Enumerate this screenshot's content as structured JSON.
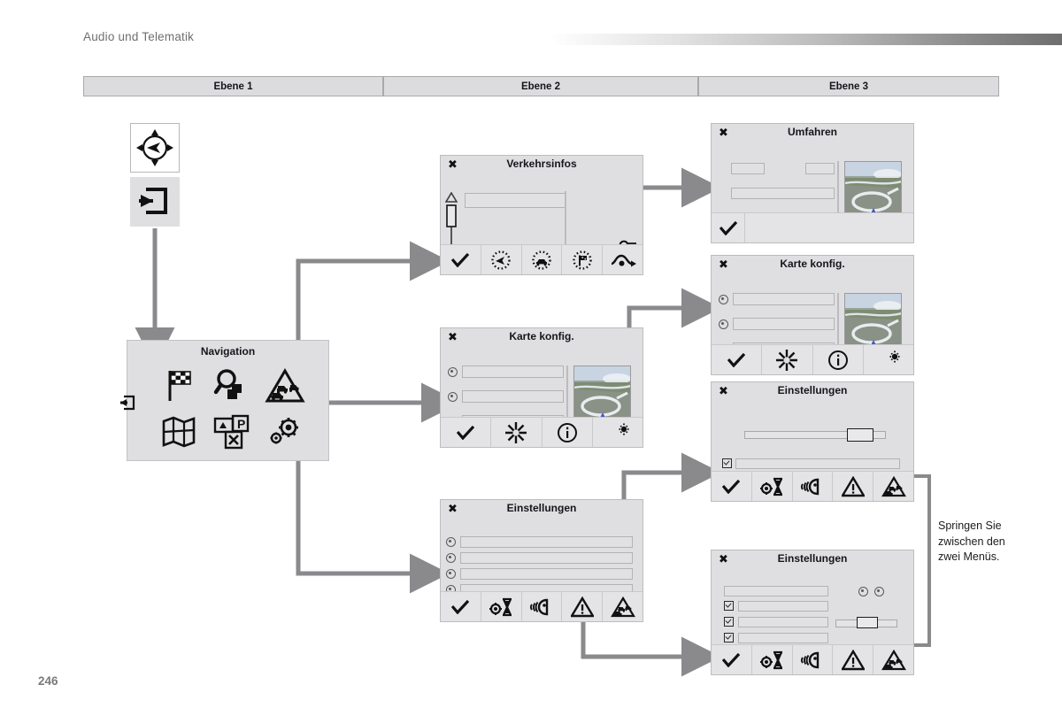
{
  "header": {
    "title": "Audio und Telematik",
    "page_number": "246"
  },
  "columns": [
    {
      "label": "Ebene 1"
    },
    {
      "label": "Ebene 2"
    },
    {
      "label": "Ebene 3"
    }
  ],
  "entry_controls": [
    {
      "name": "dpad-icon",
      "label": "joystick-dpad"
    },
    {
      "name": "enter-menu-icon",
      "label": "enter-menu"
    }
  ],
  "navigation_panel": {
    "title": "Navigation",
    "exit_icon": "exit-left-icon",
    "items": [
      {
        "icon": "checkered-flag-icon",
        "label": "Ziel eingeben"
      },
      {
        "icon": "magnifier-files-icon",
        "label": "Adressbuch"
      },
      {
        "icon": "traffic-jam-icon",
        "label": "Verkehrsinfos"
      },
      {
        "icon": "map-icon",
        "label": "Karte"
      },
      {
        "icon": "poi-parking-restaurant-icon",
        "label": "POI"
      },
      {
        "icon": "gears-icon",
        "label": "Einstellungen"
      }
    ]
  },
  "screens": {
    "verkehrsinfos": {
      "title": "Verkehrsinfos",
      "close_icon": "close-icon",
      "scrollbar": {
        "up_icon": "triangle-up-icon",
        "down_icon": "triangle-down-icon"
      },
      "list_field": "",
      "corner_icon": "traffic-list-icon",
      "toolbar": [
        {
          "icon": "check-icon",
          "label": "OK"
        },
        {
          "icon": "dotted-navigation-arrow-icon",
          "label": "Navigation"
        },
        {
          "icon": "dotted-car-icon",
          "label": "Fahrzeug"
        },
        {
          "icon": "dotted-flag-icon",
          "label": "Ziel"
        },
        {
          "icon": "detour-route-icon",
          "label": "Umfahren"
        }
      ]
    },
    "umfahren": {
      "title": "Umfahren",
      "close_icon": "close-icon",
      "fields": [
        "",
        "",
        "",
        ""
      ],
      "thumbnail": "map-preview",
      "toolbar": [
        {
          "icon": "check-icon",
          "label": "OK"
        }
      ]
    },
    "karte_konfig_l2": {
      "title": "Karte konfig.",
      "close_icon": "close-icon",
      "rows": [
        {
          "control": "radio",
          "value": ""
        },
        {
          "control": "radio",
          "value": ""
        },
        {
          "control": "radio",
          "value": ""
        }
      ],
      "thumbnail": "map-preview",
      "toolbar": [
        {
          "icon": "check-icon",
          "label": "OK"
        },
        {
          "icon": "brightness-star-icon",
          "label": "Helligkeit"
        },
        {
          "icon": "info-icon",
          "label": "Info"
        },
        {
          "icon": "day-night-icon",
          "label": "Tag/Nacht"
        }
      ]
    },
    "karte_konfig_l3": {
      "title": "Karte konfig.",
      "close_icon": "close-icon",
      "rows": [
        {
          "control": "radio",
          "value": ""
        },
        {
          "control": "radio",
          "value": ""
        },
        {
          "control": "radio",
          "value": ""
        }
      ],
      "thumbnail": "map-preview",
      "toolbar": [
        {
          "icon": "check-icon",
          "label": "OK"
        },
        {
          "icon": "brightness-star-icon",
          "label": "Helligkeit"
        },
        {
          "icon": "info-icon",
          "label": "Info"
        },
        {
          "icon": "day-night-icon",
          "label": "Tag/Nacht"
        }
      ]
    },
    "einstellungen_l2": {
      "title": "Einstellungen",
      "close_icon": "close-icon",
      "radio_rows": [
        "",
        "",
        "",
        ""
      ],
      "checkbox_row": [
        "",
        "",
        ""
      ],
      "extra_radios": 2,
      "toolbar": [
        {
          "icon": "check-icon",
          "label": "OK"
        },
        {
          "icon": "gear-hourglass-icon",
          "label": "System"
        },
        {
          "icon": "voice-icon",
          "label": "Sprache"
        },
        {
          "icon": "warning-triangle-icon",
          "label": "Warnungen"
        },
        {
          "icon": "traffic-jam-icon",
          "label": "Verkehr"
        }
      ]
    },
    "einstellungen_l3_top": {
      "title": "Einstellungen",
      "close_icon": "close-icon",
      "slider": {
        "value": 78
      },
      "checkbox_rows": [
        "",
        ""
      ],
      "toolbar": [
        {
          "icon": "check-icon",
          "label": "OK"
        },
        {
          "icon": "gear-hourglass-icon",
          "label": "System"
        },
        {
          "icon": "voice-icon",
          "label": "Sprache"
        },
        {
          "icon": "warning-triangle-icon",
          "label": "Warnungen"
        },
        {
          "icon": "traffic-jam-icon",
          "label": "Verkehr"
        }
      ]
    },
    "einstellungen_l3_bottom": {
      "title": "Einstellungen",
      "close_icon": "close-icon",
      "top_field": "",
      "top_radios": 2,
      "checkbox_rows": [
        "",
        "",
        "",
        ""
      ],
      "slider": {
        "value": 48
      },
      "toolbar": [
        {
          "icon": "check-icon",
          "label": "OK"
        },
        {
          "icon": "gear-hourglass-icon",
          "label": "System"
        },
        {
          "icon": "voice-icon",
          "label": "Sprache"
        },
        {
          "icon": "warning-triangle-icon",
          "label": "Warnungen"
        },
        {
          "icon": "traffic-jam-icon",
          "label": "Verkehr"
        }
      ]
    }
  },
  "note": {
    "text": "Springen Sie zwischen den zwei Menüs."
  },
  "colors": {
    "panel_bg": "#dfdfe1",
    "connector": "#8a8a8d",
    "header_text": "#6f6f6f",
    "table_header_bg": "#dcdcde"
  }
}
